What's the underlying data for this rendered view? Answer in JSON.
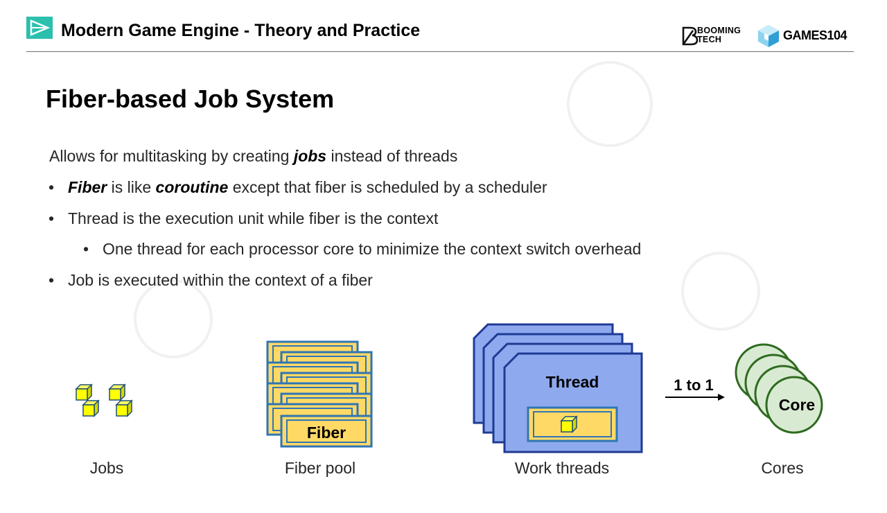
{
  "header": {
    "course_title": "Modern Game Engine - Theory and Practice",
    "brand_booming": "BOOMING",
    "brand_tech": "TECH",
    "brand_games": "GAMES104",
    "accent_color": "#2bbfae"
  },
  "slide": {
    "title": "Fiber-based Job System",
    "intro": {
      "prefix": "Allows for multitasking by creating ",
      "emph": "jobs",
      "suffix": " instead of threads"
    },
    "bullets": [
      {
        "emph1": "Fiber",
        "mid": " is like ",
        "emph2": "coroutine",
        "rest": " except that fiber is scheduled by a scheduler"
      },
      {
        "text": "Thread is the execution unit while fiber is the context"
      },
      {
        "text": "One thread for each processor core to minimize the context switch overhead"
      },
      {
        "text": "Job is executed within the context of a fiber"
      }
    ],
    "bullet_symbol": "•"
  },
  "diagram": {
    "fiber_label": "Fiber",
    "thread_label": "Thread",
    "mapping_label": "1 to 1",
    "core_label": "Core",
    "captions": {
      "jobs": "Jobs",
      "fiber_pool": "Fiber pool",
      "work_threads": "Work threads",
      "cores": "Cores"
    },
    "colors": {
      "job_cube": "#ffff00",
      "fiber_fill": "#ffd966",
      "fiber_border": "#2e75b6",
      "thread_fill": "#8ea9ee",
      "thread_border": "#1f3a93",
      "core_fill": "#d9ead3",
      "core_border": "#2e6b1f"
    }
  }
}
